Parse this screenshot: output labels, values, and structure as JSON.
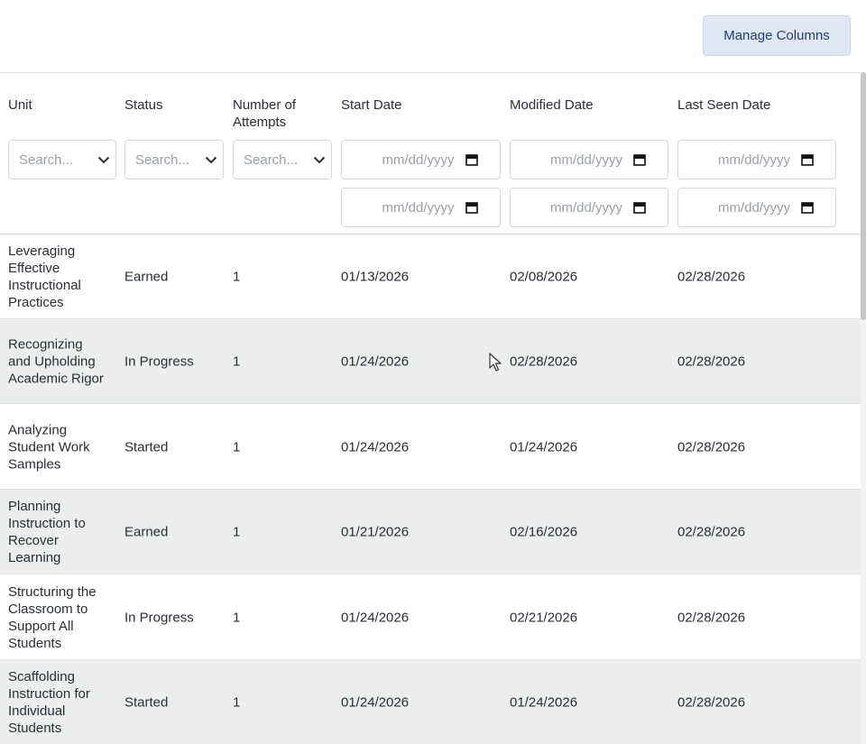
{
  "toolbar": {
    "manage_columns_label": "Manage Columns"
  },
  "columns": {
    "unit": "Unit",
    "status": "Status",
    "attempts_line1": "Number of",
    "attempts_line2": "Attempts",
    "start_date": "Start Date",
    "modified_date": "Modified Date",
    "last_seen_date": "Last Seen Date"
  },
  "filters": {
    "unit_placeholder": "Search...",
    "status_placeholder": "Search...",
    "attempts_placeholder": "Search...",
    "date_placeholder": "mm/dd/yyyy"
  },
  "rows": [
    {
      "unit": [
        "Leveraging",
        "Effective",
        "Instructional",
        "Practices"
      ],
      "status": "Earned",
      "attempts": "1",
      "start": "01/13/2026",
      "modified": "02/08/2026",
      "lastseen": "02/28/2026"
    },
    {
      "unit": [
        "Recognizing",
        "and Upholding",
        "Academic Rigor"
      ],
      "status": "In Progress",
      "attempts": "1",
      "start": "01/24/2026",
      "modified": "02/28/2026",
      "lastseen": "02/28/2026"
    },
    {
      "unit": [
        "Analyzing",
        "Student Work",
        "Samples"
      ],
      "status": "Started",
      "attempts": "1",
      "start": "01/24/2026",
      "modified": "01/24/2026",
      "lastseen": "02/28/2026"
    },
    {
      "unit": [
        "Planning",
        "Instruction to",
        "Recover",
        "Learning"
      ],
      "status": "Earned",
      "attempts": "1",
      "start": "01/21/2026",
      "modified": "02/16/2026",
      "lastseen": "02/28/2026"
    },
    {
      "unit": [
        "Structuring the",
        "Classroom to",
        "Support All",
        "Students"
      ],
      "status": "In Progress",
      "attempts": "1",
      "start": "01/24/2026",
      "modified": "02/21/2026",
      "lastseen": "02/28/2026"
    },
    {
      "unit": [
        "Scaffolding",
        "Instruction for",
        "Individual",
        "Students"
      ],
      "status": "Started",
      "attempts": "1",
      "start": "01/24/2026",
      "modified": "01/24/2026",
      "lastseen": "02/28/2026"
    }
  ],
  "colors": {
    "button_bg": "#dfe8f2",
    "button_text": "#1f3f73",
    "alt_row_bg": "#eceeee"
  },
  "icons": {
    "dropdown": "chevron-down-icon",
    "date": "calendar-icon",
    "pointer": "mouse-cursor-icon"
  }
}
